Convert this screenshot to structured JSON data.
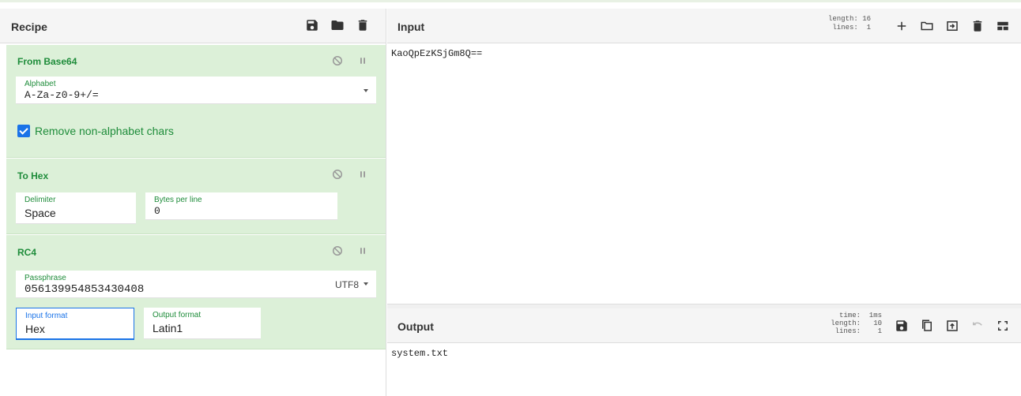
{
  "recipe": {
    "title": "Recipe",
    "icons": [
      "save-icon",
      "folder-icon",
      "trash-icon"
    ]
  },
  "ops": [
    {
      "title": "From Base64",
      "alphabet_label": "Alphabet",
      "alphabet_value": "A-Za-z0-9+/=",
      "remove_label": "Remove non-alphabet chars"
    },
    {
      "title": "To Hex",
      "delimiter_label": "Delimiter",
      "delimiter_value": "Space",
      "bpl_label": "Bytes per line",
      "bpl_value": "0"
    },
    {
      "title": "RC4",
      "pass_label": "Passphrase",
      "pass_value": "056139954853430408",
      "pass_encoding": "UTF8",
      "infmt_label": "Input format",
      "infmt_value": "Hex",
      "outfmt_label": "Output format",
      "outfmt_value": "Latin1"
    }
  ],
  "input": {
    "title": "Input",
    "length_line": "length: 16",
    "lines_line": " lines:  1",
    "text": "KaoQpEzKSjGm8Q=="
  },
  "output": {
    "title": "Output",
    "time_line": "  time:  1ms",
    "length_line": "length:   10",
    "lines_line": " lines:    1",
    "text": "system.txt"
  },
  "colors": {
    "accent": "#1e8c3a",
    "op_bg": "#dcf0d8",
    "focus": "#1a73e8"
  }
}
